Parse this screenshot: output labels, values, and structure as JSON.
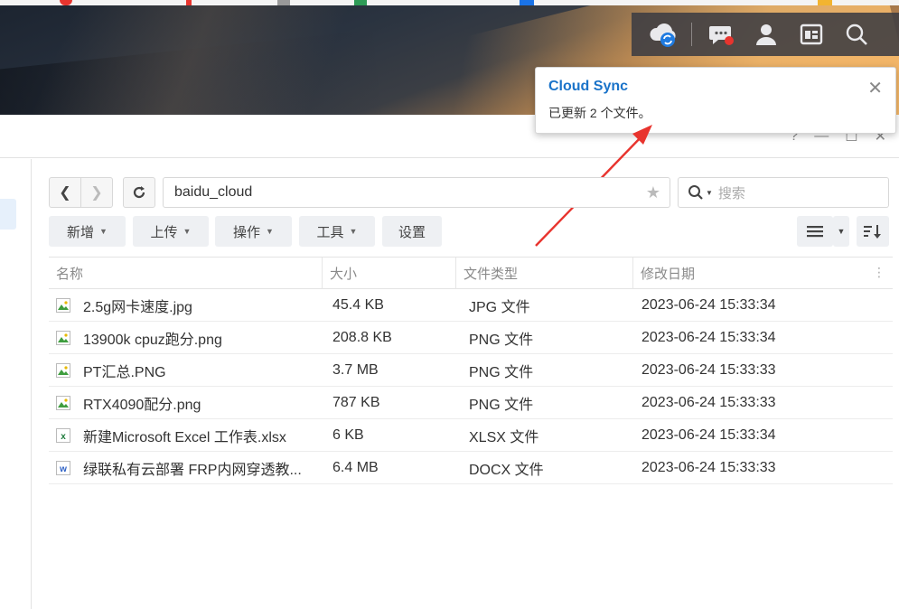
{
  "notification": {
    "title": "Cloud Sync",
    "message": "已更新 2 个文件。"
  },
  "address_bar": {
    "path": "baidu_cloud"
  },
  "search": {
    "placeholder": "搜索"
  },
  "toolbar": {
    "new_label": "新增",
    "upload_label": "上传",
    "actions_label": "操作",
    "tools_label": "工具",
    "settings_label": "设置"
  },
  "table": {
    "columns": [
      "名称",
      "大小",
      "文件类型",
      "修改日期"
    ],
    "rows": [
      {
        "name": "2.5g网卡速度.jpg",
        "size": "45.4 KB",
        "type": "JPG 文件",
        "modified": "2023-06-24 15:33:34",
        "icon": "image-file-icon"
      },
      {
        "name": "13900k cpuz跑分.png",
        "size": "208.8 KB",
        "type": "PNG 文件",
        "modified": "2023-06-24 15:33:34",
        "icon": "image-file-icon"
      },
      {
        "name": "PT汇总.PNG",
        "size": "3.7 MB",
        "type": "PNG 文件",
        "modified": "2023-06-24 15:33:33",
        "icon": "image-file-icon"
      },
      {
        "name": "RTX4090配分.png",
        "size": "787 KB",
        "type": "PNG 文件",
        "modified": "2023-06-24 15:33:33",
        "icon": "image-file-icon"
      },
      {
        "name": "新建Microsoft Excel 工作表.xlsx",
        "size": "6 KB",
        "type": "XLSX 文件",
        "modified": "2023-06-24 15:33:34",
        "icon": "excel-file-icon"
      },
      {
        "name": "绿联私有云部署 FRP内网穿透教...",
        "size": "6.4 MB",
        "type": "DOCX 文件",
        "modified": "2023-06-24 15:33:33",
        "icon": "word-file-icon"
      }
    ]
  },
  "colors": {
    "accent": "#1a73c9",
    "arrow": "#e8342e"
  }
}
